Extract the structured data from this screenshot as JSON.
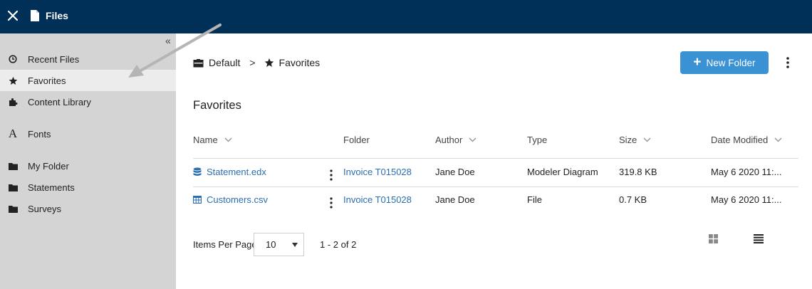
{
  "app": {
    "title": "Files"
  },
  "sidebar": {
    "collapse_glyph": "«",
    "items": [
      {
        "label": "Recent Files",
        "icon": "clock-icon"
      },
      {
        "label": "Favorites",
        "icon": "star-icon",
        "active": true
      },
      {
        "label": "Content Library",
        "icon": "puzzle-icon"
      },
      {
        "label": "Fonts",
        "icon": "font-icon"
      },
      {
        "label": "My Folder",
        "icon": "folder-icon"
      },
      {
        "label": "Statements",
        "icon": "folder-icon"
      },
      {
        "label": "Surveys",
        "icon": "folder-icon"
      }
    ]
  },
  "breadcrumb": {
    "root": "Default",
    "separator": ">",
    "current": "Favorites"
  },
  "toolbar": {
    "new_folder_label": "New Folder"
  },
  "main": {
    "section_title": "Favorites"
  },
  "table": {
    "columns": [
      "Name",
      "Folder",
      "Author",
      "Type",
      "Size",
      "Date Modified"
    ],
    "rows": [
      {
        "name": "Statement.edx",
        "icon": "database-icon",
        "folder": "Invoice T015028",
        "author": "Jane Doe",
        "type": "Modeler Diagram",
        "size": "319.8 KB",
        "date_modified": "May 6 2020 11:..."
      },
      {
        "name": "Customers.csv",
        "icon": "table-icon",
        "folder": "Invoice T015028",
        "author": "Jane Doe",
        "type": "File",
        "size": "0.7 KB",
        "date_modified": "May 6 2020 11:..."
      }
    ]
  },
  "pagination": {
    "items_per_page_label": "Items Per Page",
    "items_per_page_value": "10",
    "range_text": "1 - 2 of 2"
  },
  "colors": {
    "topbar": "#003057",
    "sidebar": "#d4d4d4",
    "accent_button": "#3a91d4",
    "link": "#2a6fb0"
  }
}
